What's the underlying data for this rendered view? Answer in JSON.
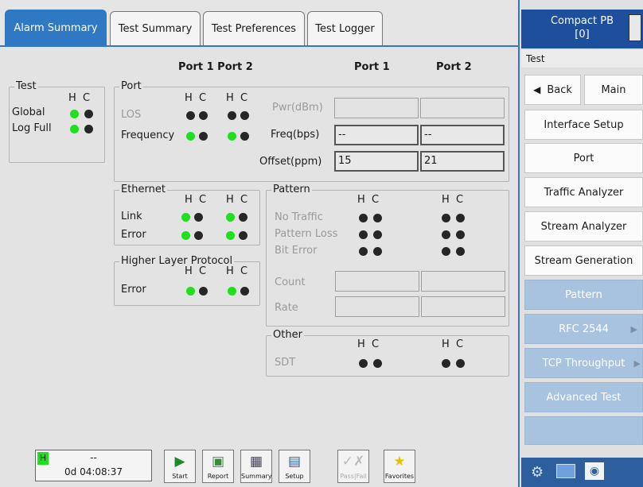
{
  "tabs": [
    "Alarm Summary",
    "Test Summary",
    "Test Preferences",
    "Test Logger"
  ],
  "headers": {
    "ports_left": "Port 1 Port 2",
    "port1": "Port 1",
    "port2": "Port 2"
  },
  "hc_label": "H  C",
  "test_group": {
    "title": "Test",
    "rows": [
      "Global",
      "Log Full"
    ]
  },
  "port_group": {
    "title": "Port",
    "rows": [
      "LOS",
      "Frequency"
    ],
    "fields": [
      "Pwr(dBm)",
      "Freq(bps)",
      "Offset(ppm)"
    ],
    "values": {
      "pwr": [
        "",
        ""
      ],
      "freq": [
        "--",
        "--"
      ],
      "offset": [
        "15",
        "21"
      ]
    }
  },
  "ethernet_group": {
    "title": "Ethernet",
    "rows": [
      "Link",
      "Error"
    ]
  },
  "hlp_group": {
    "title": "Higher Layer Protocol",
    "rows": [
      "Error"
    ]
  },
  "pattern_group": {
    "title": "Pattern",
    "rows": [
      "No Traffic",
      "Pattern Loss",
      "Bit Error",
      "Count",
      "Rate"
    ]
  },
  "other_group": {
    "title": "Other",
    "rows": [
      "SDT"
    ]
  },
  "status": {
    "indicator": "H",
    "value": "--",
    "time": "0d 04:08:37",
    "indicator_color": "#1fe01f"
  },
  "toolbar": [
    "Start",
    "Report",
    "Summary",
    "Setup",
    "Pass|Fail",
    "Favorites"
  ],
  "side": {
    "title": "Compact PB",
    "subtitle": "[0]",
    "section": "Test",
    "back": "Back",
    "main": "Main",
    "items": [
      "Interface Setup",
      "Port",
      "Traffic Analyzer",
      "Stream Analyzer",
      "Stream Generation",
      "Pattern",
      "RFC 2544",
      "TCP Throughput",
      "Advanced Test"
    ]
  },
  "colors": {
    "accent": "#2f79c4",
    "led_on": "#1fe01f",
    "led_off": "#262626",
    "disabled_button": "#a7c3df"
  }
}
